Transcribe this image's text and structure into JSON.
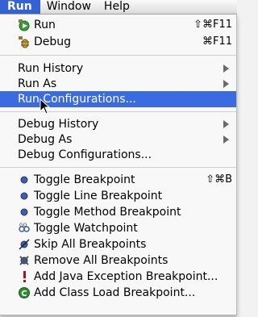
{
  "menubar": {
    "items": [
      {
        "label": "Run"
      },
      {
        "label": "Window"
      },
      {
        "label": "Help"
      }
    ]
  },
  "menu": {
    "items": [
      {
        "label": "Run",
        "shortcut": "⇧⌘F11",
        "icon": "run-icon"
      },
      {
        "label": "Debug",
        "shortcut": "⌘F11",
        "icon": "debug-icon"
      },
      {
        "label": "Run History",
        "submenu": true
      },
      {
        "label": "Run As",
        "submenu": true
      },
      {
        "label": "Run Configurations...",
        "highlighted": true
      },
      {
        "label": "Debug History",
        "submenu": true
      },
      {
        "label": "Debug As",
        "submenu": true
      },
      {
        "label": "Debug Configurations..."
      },
      {
        "label": "Toggle Breakpoint",
        "shortcut": "⇧⌘B",
        "icon": "breakpoint-icon"
      },
      {
        "label": "Toggle Line Breakpoint",
        "icon": "line-breakpoint-icon"
      },
      {
        "label": "Toggle Method Breakpoint",
        "icon": "method-breakpoint-icon"
      },
      {
        "label": "Toggle Watchpoint",
        "icon": "watchpoint-icon"
      },
      {
        "label": "Skip All Breakpoints",
        "icon": "skip-breakpoints-icon"
      },
      {
        "label": "Remove All Breakpoints",
        "icon": "remove-breakpoints-icon"
      },
      {
        "label": "Add Java Exception Breakpoint...",
        "icon": "exception-breakpoint-icon"
      },
      {
        "label": "Add Class Load Breakpoint...",
        "icon": "class-load-breakpoint-icon"
      }
    ]
  },
  "colors": {
    "highlight": "#3b6be0",
    "menubar_active": "#3462d3"
  }
}
